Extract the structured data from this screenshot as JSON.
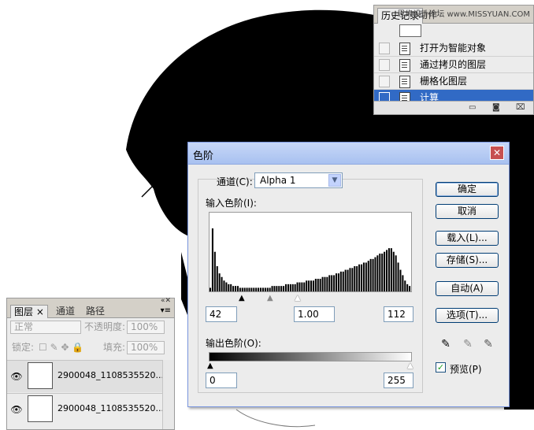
{
  "history_panel": {
    "tabs": [
      "历史记录",
      "动作"
    ],
    "watermark": "思缘设计论坛 www.MISSYUAN.COM",
    "items": [
      {
        "label": "打开为智能对象",
        "selected": false
      },
      {
        "label": "通过拷贝的图层",
        "selected": false
      },
      {
        "label": "栅格化图层",
        "selected": false
      },
      {
        "label": "计算",
        "selected": true
      }
    ],
    "footer_icons": [
      "new-document-icon",
      "camera-icon",
      "trash-icon"
    ]
  },
  "levels_dialog": {
    "title": "色阶",
    "channel_label": "通道(C):",
    "channel_value": "Alpha 1",
    "input_levels_label": "输入色阶(I):",
    "input_black": "42",
    "input_gamma": "1.00",
    "input_white": "112",
    "output_levels_label": "输出色阶(O):",
    "output_black": "0",
    "output_white": "255",
    "buttons": {
      "ok": "确定",
      "cancel": "取消",
      "load": "载入(L)...",
      "save": "存储(S)...",
      "auto": "自动(A)",
      "options": "选项(T)..."
    },
    "preview_label": "预览(P)",
    "preview_checked": true,
    "histogram": [
      2,
      35,
      22,
      14,
      10,
      8,
      6,
      5,
      4,
      4,
      3,
      3,
      3,
      2,
      2,
      2,
      2,
      2,
      2,
      2,
      2,
      2,
      2,
      2,
      2,
      2,
      2,
      3,
      3,
      3,
      3,
      3,
      3,
      4,
      4,
      4,
      4,
      4,
      5,
      5,
      5,
      5,
      6,
      6,
      6,
      6,
      7,
      7,
      7,
      8,
      8,
      8,
      9,
      9,
      9,
      10,
      10,
      11,
      11,
      12,
      12,
      13,
      13,
      14,
      14,
      15,
      15,
      16,
      16,
      17,
      18,
      18,
      19,
      20,
      21,
      21,
      22,
      23,
      24,
      24,
      22,
      20,
      16,
      12,
      9,
      6,
      4,
      3
    ]
  },
  "layers_panel": {
    "tabs": [
      "图层",
      "通道",
      "路径"
    ],
    "blend_mode": "正常",
    "opacity_label": "不透明度:",
    "opacity_value": "100%",
    "lock_label": "锁定:",
    "fill_label": "填充:",
    "fill_value": "100%",
    "layers": [
      {
        "name": "2900048_1108535520..."
      },
      {
        "name": "2900048_1108535520..."
      }
    ]
  }
}
